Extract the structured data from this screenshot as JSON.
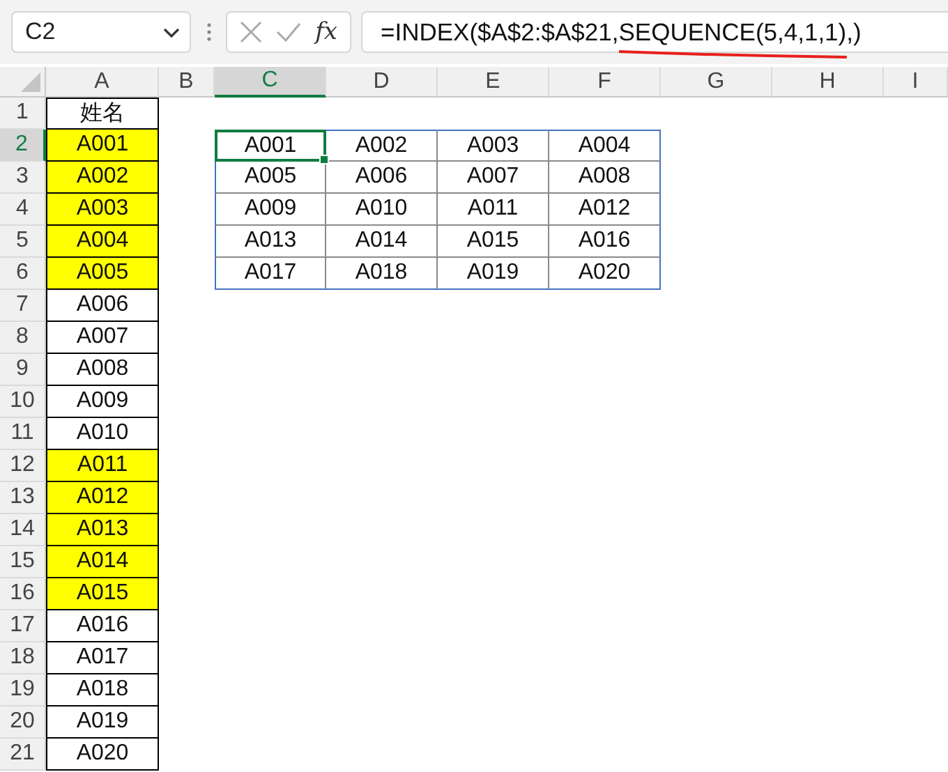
{
  "name_box": {
    "value": "C2"
  },
  "formula_bar": {
    "function_label": "fx",
    "formula": [
      {
        "text": "=INDEX($A$2:$A$21,",
        "underlined": false
      },
      {
        "text": "SEQUENCE(5,4,1,1)",
        "underlined": true
      },
      {
        "text": ",)",
        "underlined": false
      }
    ]
  },
  "column_headers": [
    {
      "label": "A",
      "selected": false
    },
    {
      "label": "B",
      "selected": false
    },
    {
      "label": "C",
      "selected": true
    },
    {
      "label": "D",
      "selected": false
    },
    {
      "label": "E",
      "selected": false
    },
    {
      "label": "F",
      "selected": false
    },
    {
      "label": "G",
      "selected": false
    },
    {
      "label": "H",
      "selected": false
    },
    {
      "label": "I",
      "selected": false
    }
  ],
  "row_headers": [
    {
      "label": "1",
      "selected": false
    },
    {
      "label": "2",
      "selected": true
    },
    {
      "label": "3",
      "selected": false
    },
    {
      "label": "4",
      "selected": false
    },
    {
      "label": "5",
      "selected": false
    },
    {
      "label": "6",
      "selected": false
    },
    {
      "label": "7",
      "selected": false
    },
    {
      "label": "8",
      "selected": false
    },
    {
      "label": "9",
      "selected": false
    },
    {
      "label": "10",
      "selected": false
    },
    {
      "label": "11",
      "selected": false
    },
    {
      "label": "12",
      "selected": false
    },
    {
      "label": "13",
      "selected": false
    },
    {
      "label": "14",
      "selected": false
    },
    {
      "label": "15",
      "selected": false
    },
    {
      "label": "16",
      "selected": false
    },
    {
      "label": "17",
      "selected": false
    },
    {
      "label": "18",
      "selected": false
    },
    {
      "label": "19",
      "selected": false
    },
    {
      "label": "20",
      "selected": false
    },
    {
      "label": "21",
      "selected": false
    }
  ],
  "column_a": [
    {
      "value": "姓名",
      "highlighted": false
    },
    {
      "value": "A001",
      "highlighted": true
    },
    {
      "value": "A002",
      "highlighted": true
    },
    {
      "value": "A003",
      "highlighted": true
    },
    {
      "value": "A004",
      "highlighted": true
    },
    {
      "value": "A005",
      "highlighted": true
    },
    {
      "value": "A006",
      "highlighted": false
    },
    {
      "value": "A007",
      "highlighted": false
    },
    {
      "value": "A008",
      "highlighted": false
    },
    {
      "value": "A009",
      "highlighted": false
    },
    {
      "value": "A010",
      "highlighted": false
    },
    {
      "value": "A011",
      "highlighted": true
    },
    {
      "value": "A012",
      "highlighted": true
    },
    {
      "value": "A013",
      "highlighted": true
    },
    {
      "value": "A014",
      "highlighted": true
    },
    {
      "value": "A015",
      "highlighted": true
    },
    {
      "value": "A016",
      "highlighted": false
    },
    {
      "value": "A017",
      "highlighted": false
    },
    {
      "value": "A018",
      "highlighted": false
    },
    {
      "value": "A019",
      "highlighted": false
    },
    {
      "value": "A020",
      "highlighted": false
    }
  ],
  "spill_range": [
    [
      {
        "value": "A001",
        "selected": true
      },
      {
        "value": "A002",
        "selected": false
      },
      {
        "value": "A003",
        "selected": false
      },
      {
        "value": "A004",
        "selected": false
      }
    ],
    [
      {
        "value": "A005",
        "selected": false
      },
      {
        "value": "A006",
        "selected": false
      },
      {
        "value": "A007",
        "selected": false
      },
      {
        "value": "A008",
        "selected": false
      }
    ],
    [
      {
        "value": "A009",
        "selected": false
      },
      {
        "value": "A010",
        "selected": false
      },
      {
        "value": "A011",
        "selected": false
      },
      {
        "value": "A012",
        "selected": false
      }
    ],
    [
      {
        "value": "A013",
        "selected": false
      },
      {
        "value": "A014",
        "selected": false
      },
      {
        "value": "A015",
        "selected": false
      },
      {
        "value": "A016",
        "selected": false
      }
    ],
    [
      {
        "value": "A017",
        "selected": false
      },
      {
        "value": "A018",
        "selected": false
      },
      {
        "value": "A019",
        "selected": false
      },
      {
        "value": "A020",
        "selected": false
      }
    ]
  ]
}
